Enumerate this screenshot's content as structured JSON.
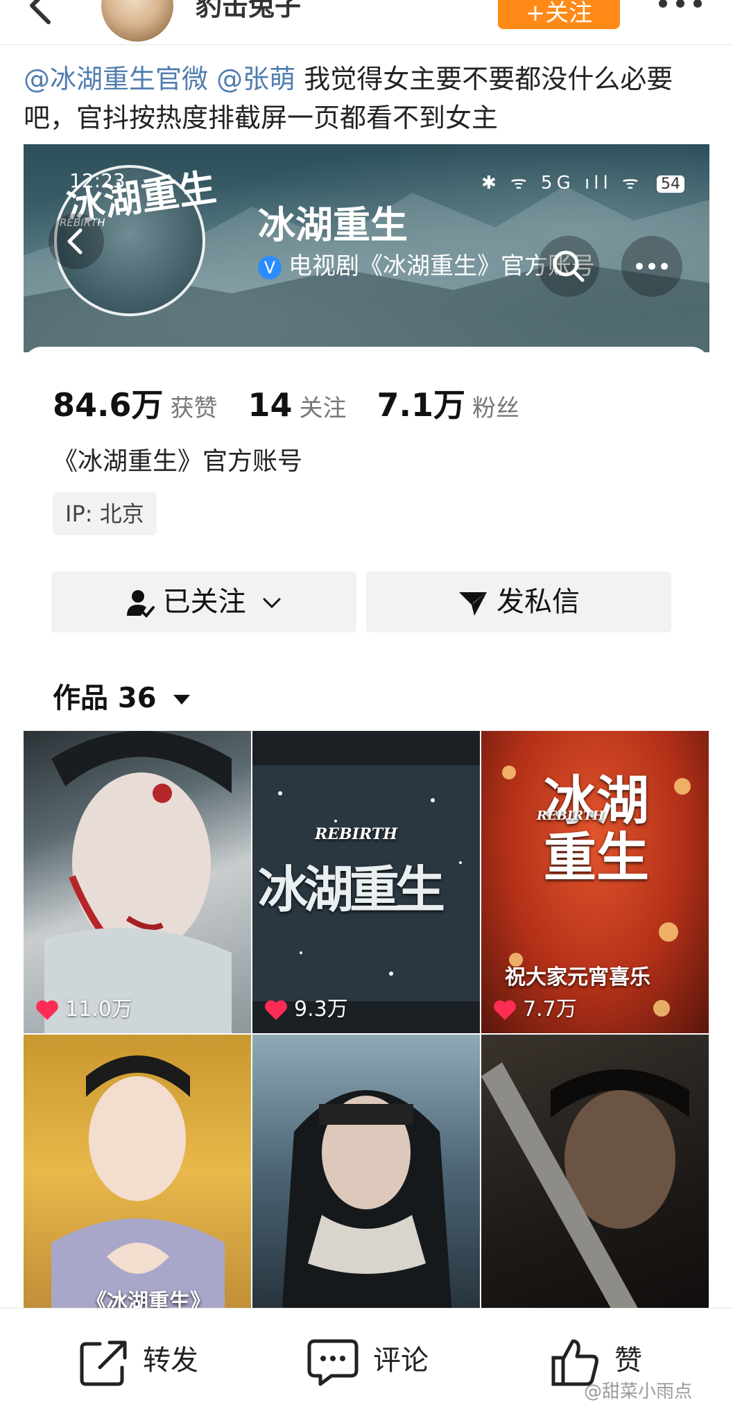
{
  "header": {
    "username": "豹击兔子",
    "follow_button": "+关注"
  },
  "post": {
    "mentions": [
      "@冰湖重生官微",
      "@张萌"
    ],
    "text": "我觉得女主要不要都没什么必要吧，官抖按热度排截屏一页都看不到女主"
  },
  "screenshot": {
    "status_time": "12:23",
    "status_icons": "✱ ᯤ 5G ıll ᯤ",
    "battery": "54",
    "logo_title": "冰湖重生",
    "logo_rebirth": "REBIRTH",
    "account_name": "冰湖重生",
    "verified_text": "电视剧《冰湖重生》官方账号",
    "stats": [
      {
        "value": "84.6万",
        "label": "获赞"
      },
      {
        "value": "14",
        "label": "关注"
      },
      {
        "value": "7.1万",
        "label": "粉丝"
      }
    ],
    "bio": "《冰湖重生》官方账号",
    "ip": "IP: 北京",
    "followed_button": "已关注",
    "message_button": "发私信",
    "works_label": "作品 36",
    "videos": [
      {
        "likes": "11.0万",
        "caption": ""
      },
      {
        "likes": "9.3万",
        "caption": "冰湖重生"
      },
      {
        "likes": "7.7万",
        "caption": "祝大家元宵喜乐"
      },
      {
        "likes": "",
        "caption": "《冰湖重生》"
      },
      {
        "likes": "",
        "caption": ""
      },
      {
        "likes": "",
        "caption": ""
      }
    ],
    "video_overlay_rebirth": "REBIRTH",
    "video_caption_big": "冰湖重生"
  },
  "actions": {
    "repost": "转发",
    "comment": "评论",
    "like": "赞"
  },
  "watermark": "@甜菜小雨点",
  "colors": {
    "mention": "#507daf",
    "follow": "#ff8a18",
    "heart": "#ff2d55"
  }
}
